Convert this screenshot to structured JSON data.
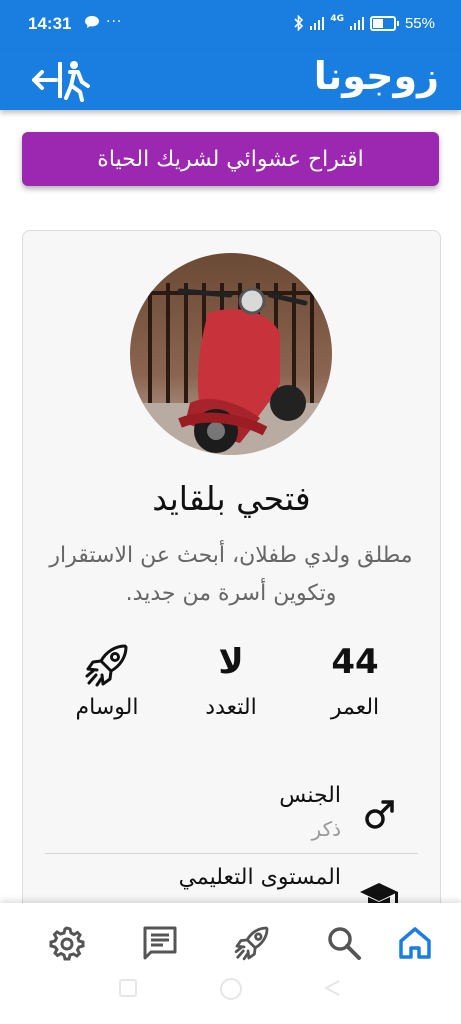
{
  "status_bar": {
    "time": "14:31",
    "left_icons": [
      "chat-bubble-icon",
      "more-dots-icon"
    ],
    "dots": "···",
    "network": "4G",
    "battery": "55%"
  },
  "app_bar": {
    "title": "زوجونا",
    "exit_icon": "exit-walk-icon"
  },
  "suggest_button": {
    "label": "اقتراح عشوائي لشريك الحياة"
  },
  "profile": {
    "name": "فتحي بلقايد",
    "bio": "مطلق ولدي طفلان، أبحث عن الاستقرار وتكوين أسرة من جديد.",
    "stats": [
      {
        "value": "44",
        "label": "العمر"
      },
      {
        "value": "لا",
        "label": "التعدد"
      },
      {
        "icon": "rocket-icon",
        "label": "الوسام"
      }
    ],
    "info": [
      {
        "title": "الجنس",
        "value": "ذكر",
        "icon": "male-icon"
      },
      {
        "title": "المستوى التعليمي",
        "value": "",
        "icon": "graduation-cap-icon"
      }
    ]
  },
  "bottom_nav": {
    "items": [
      "settings-icon",
      "messages-icon",
      "rocket-icon",
      "search-icon",
      "home-icon"
    ],
    "active": "home-icon",
    "active_color": "#1a7ee0",
    "inactive_color": "#555555"
  },
  "colors": {
    "primary": "#1a7ee0",
    "accent": "#9c27b0"
  }
}
